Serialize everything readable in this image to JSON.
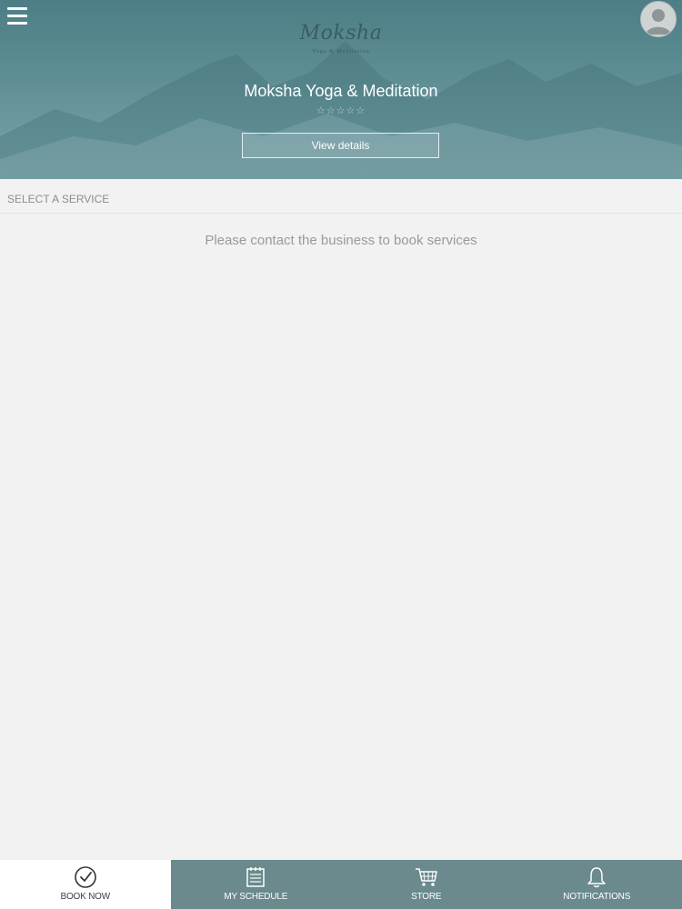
{
  "header": {
    "logo_script": "Moksha",
    "logo_sub": "Yoga & Meditation",
    "business_name": "Moksha Yoga & Meditation",
    "rating_stars": "☆☆☆☆☆",
    "view_details_label": "View details"
  },
  "main": {
    "section_label": "SELECT A SERVICE",
    "empty_message": "Please contact the business to book services"
  },
  "bottom_nav": {
    "items": [
      {
        "label": "BOOK NOW",
        "icon": "checkmark-circle-icon",
        "active": true
      },
      {
        "label": "MY SCHEDULE",
        "icon": "calendar-icon",
        "active": false
      },
      {
        "label": "STORE",
        "icon": "cart-icon",
        "active": false
      },
      {
        "label": "NOTIFICATIONS",
        "icon": "bell-icon",
        "active": false
      }
    ]
  },
  "colors": {
    "header_teal": "#5f8f95",
    "nav_bg": "#6a8a8d",
    "page_bg": "#f2f2f3"
  }
}
